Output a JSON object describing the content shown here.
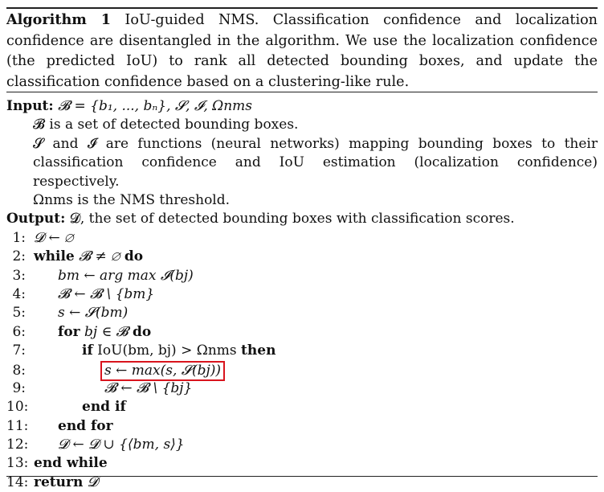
{
  "caption": {
    "label": "Algorithm 1",
    "text": " IoU-guided NMS. Classification confidence and localization confidence are disentangled in the algorithm. We use the localization confidence (the predicted IoU) to rank all detected bounding boxes, and update the classification confidence based on a clustering-like rule."
  },
  "input": {
    "label": "Input:",
    "formula": "𝓑 = {b₁, ..., bₙ},  𝓢,  𝓘,  Ωnms",
    "lines": [
      "𝓑 is a set of detected bounding boxes.",
      "𝓢 and 𝓘 are functions (neural networks) mapping bounding boxes to their classification confidence and IoU estimation (localization confidence) respectively.",
      "Ωnms is the NMS threshold."
    ]
  },
  "output": {
    "label": "Output:",
    "text": "𝓓, the set of detected bounding boxes with classification scores."
  },
  "steps": [
    {
      "num": "1:",
      "text": "𝓓 ← ∅"
    },
    {
      "num": "2:",
      "kw1": "while",
      "text": " 𝓑 ≠ ∅ ",
      "kw2": "do"
    },
    {
      "num": "3:",
      "text": "bm ← arg max 𝓘(bj)"
    },
    {
      "num": "4:",
      "text": "𝓑 ← 𝓑 \\ {bm}"
    },
    {
      "num": "5:",
      "text": "s ← 𝓢(bm)"
    },
    {
      "num": "6:",
      "kw1": "for",
      "text": " bj ∈ 𝓑 ",
      "kw2": "do"
    },
    {
      "num": "7:",
      "kw1": "if",
      "text": " IoU(bm, bj) > Ωnms ",
      "kw2": "then"
    },
    {
      "num": "8:",
      "text": "s ← max(s, 𝓢(bj))"
    },
    {
      "num": "9:",
      "text": "𝓑 ← 𝓑 \\ {bj}"
    },
    {
      "num": "10:",
      "kw1": "end if"
    },
    {
      "num": "11:",
      "kw1": "end for"
    },
    {
      "num": "12:",
      "text": "𝓓 ← 𝓓 ∪ {⟨bm, s⟩}"
    },
    {
      "num": "13:",
      "kw1": "end while"
    },
    {
      "num": "14:",
      "kw1": "return",
      "text": " 𝓓"
    }
  ],
  "highlight_color": "#d9141d"
}
